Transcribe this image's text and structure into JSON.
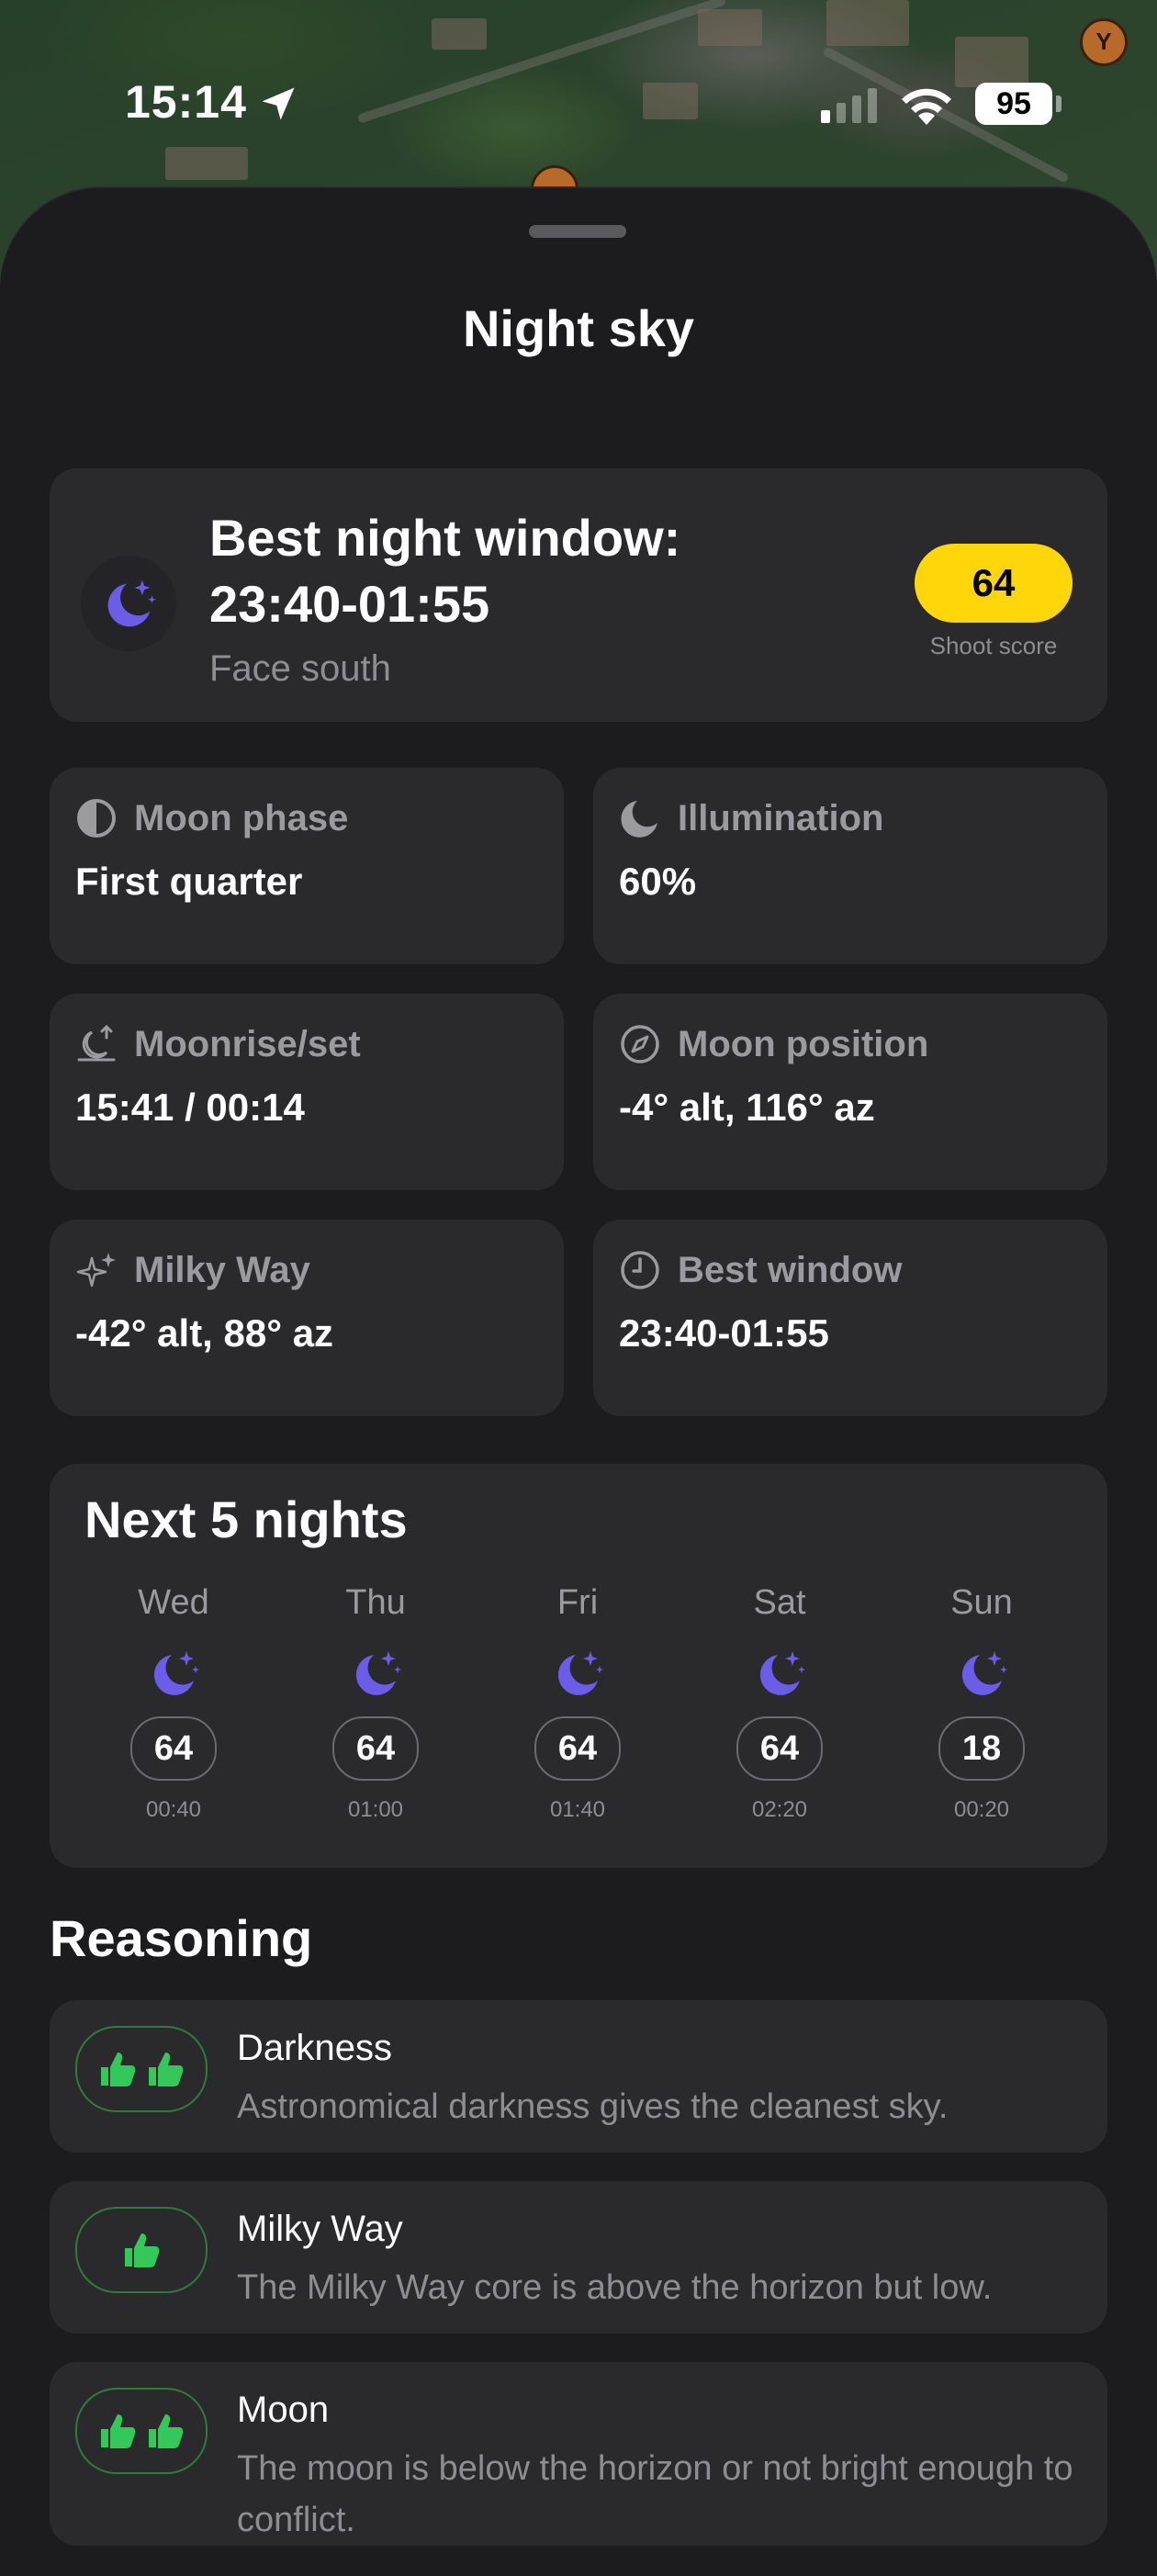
{
  "status_bar": {
    "time": "15:14",
    "battery": "95"
  },
  "sheet": {
    "title": "Night sky"
  },
  "best_window": {
    "title_line1": "Best night window:",
    "title_line2": "23:40-01:55",
    "subtitle": "Face south",
    "score": "64",
    "score_label": "Shoot score",
    "score_color": "#ffd60a"
  },
  "stats": [
    {
      "icon": "half-moon-icon",
      "label": "Moon phase",
      "value": "First quarter"
    },
    {
      "icon": "crescent-moon-icon",
      "label": "Illumination",
      "value": "60%"
    },
    {
      "icon": "moonrise-icon",
      "label": "Moonrise/set",
      "value": "15:41 / 00:14"
    },
    {
      "icon": "compass-icon",
      "label": "Moon position",
      "value": "-4° alt, 116° az"
    },
    {
      "icon": "sparkle-icon",
      "label": "Milky Way",
      "value": "-42° alt, 88° az"
    },
    {
      "icon": "clock-icon",
      "label": "Best window",
      "value": "23:40-01:55"
    }
  ],
  "next_nights": {
    "title": "Next 5 nights",
    "days": [
      {
        "day": "Wed",
        "score": "64",
        "time": "00:40"
      },
      {
        "day": "Thu",
        "score": "64",
        "time": "01:00"
      },
      {
        "day": "Fri",
        "score": "64",
        "time": "01:40"
      },
      {
        "day": "Sat",
        "score": "64",
        "time": "02:20"
      },
      {
        "day": "Sun",
        "score": "18",
        "time": "00:20"
      }
    ]
  },
  "reasoning": {
    "title": "Reasoning",
    "items": [
      {
        "title": "Darkness",
        "desc": "Astronomical darkness gives the cleanest sky.",
        "thumbs": 2
      },
      {
        "title": "Milky Way",
        "desc": "The Milky Way core is above the horizon but low.",
        "thumbs": 1
      },
      {
        "title": "Moon",
        "desc": "The moon is below the horizon or not bright enough to conflict.",
        "thumbs": 2
      }
    ]
  },
  "colors": {
    "accent_purple": "#6c5ce7",
    "thumb_green": "#34c759",
    "sheet_bg": "#1c1c1e",
    "card_bg": "#2a2a2c"
  }
}
